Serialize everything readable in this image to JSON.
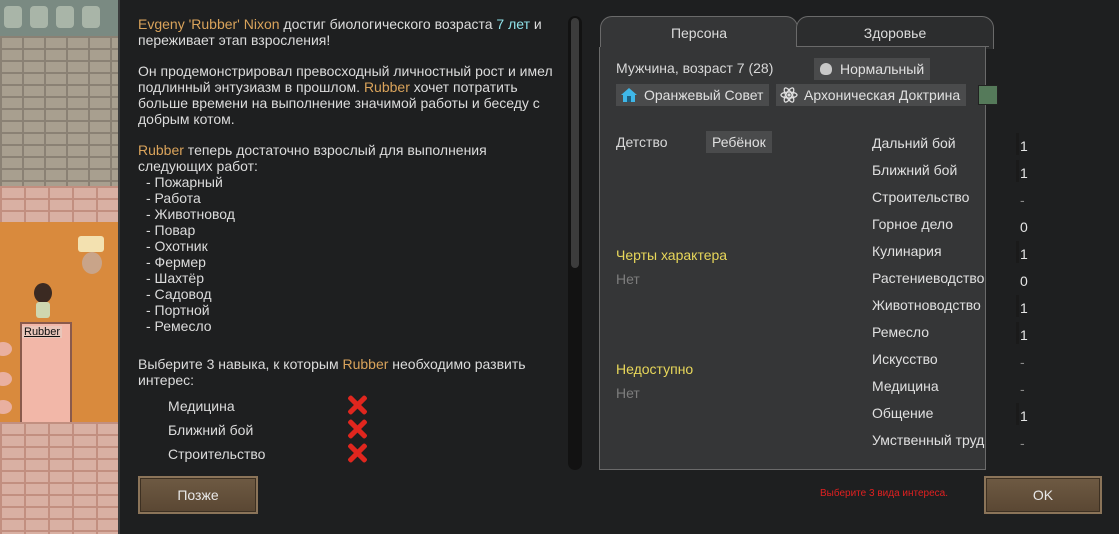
{
  "scene": {
    "pawn_label": "Rubber"
  },
  "story": {
    "pawn_name": "Evgeny 'Rubber' Nixon",
    "age_prefix": " достиг биологического возраста ",
    "age_value": "7 лет",
    "age_suffix": " и переживает этап взросления!",
    "growth_text_1": "Он продемонстрировал превосходный личностный рост и имел подлинный энтузиазм в прошлом. ",
    "nickname": "Rubber",
    "growth_text_2": " хочет потратить больше времени на выполнение значимой работы и беседу с добрым котом.",
    "work_intro": " теперь достаточно взрослый для выполнения следующих работ:",
    "work_types": [
      "- Пожарный",
      "- Работа",
      "- Животновод",
      "- Повар",
      "- Охотник",
      "- Фермер",
      "- Шахтёр",
      "- Садовод",
      "- Портной",
      "- Ремесло"
    ],
    "interest_prompt_1": "Выберите 3 навыка, к которым ",
    "interest_prompt_2": " необходимо развить интерес:",
    "interest_options": [
      "Медицина",
      "Ближний бой",
      "Строительство"
    ]
  },
  "buttons": {
    "later": "Позже",
    "ok": "OK",
    "warning": "Выберите 3 вида интереса."
  },
  "tabs": [
    "Персона",
    "Здоровье"
  ],
  "persona": {
    "gender_age": "Мужчина, возраст 7 (28)",
    "biotype": "Нормальный",
    "faction": "Оранжевый Совет",
    "ideoligion": "Архоническая Доктрина",
    "childhood_label": "Детство",
    "childhood_value": "Ребёнок",
    "traits_title": "Черты характера",
    "traits_value": "Нет",
    "unavailable_title": "Недоступно",
    "unavailable_value": "Нет"
  },
  "skills": [
    {
      "name": "Дальний бой",
      "value": "1"
    },
    {
      "name": "Ближний бой",
      "value": "1"
    },
    {
      "name": "Строительство",
      "value": "-"
    },
    {
      "name": "Горное дело",
      "value": "0"
    },
    {
      "name": "Кулинария",
      "value": "1"
    },
    {
      "name": "Растениеводство",
      "value": "0"
    },
    {
      "name": "Животноводство",
      "value": "1"
    },
    {
      "name": "Ремесло",
      "value": "1"
    },
    {
      "name": "Искусство",
      "value": "-"
    },
    {
      "name": "Медицина",
      "value": "-"
    },
    {
      "name": "Общение",
      "value": "1"
    },
    {
      "name": "Умственный труд",
      "value": "-"
    }
  ],
  "colors": {
    "name_orange": "#d9a35b",
    "age_cyan": "#8fe3ea",
    "section_yellow": "#e8d75a",
    "error_red": "#e02020",
    "ideo_color": "#557a5a"
  }
}
